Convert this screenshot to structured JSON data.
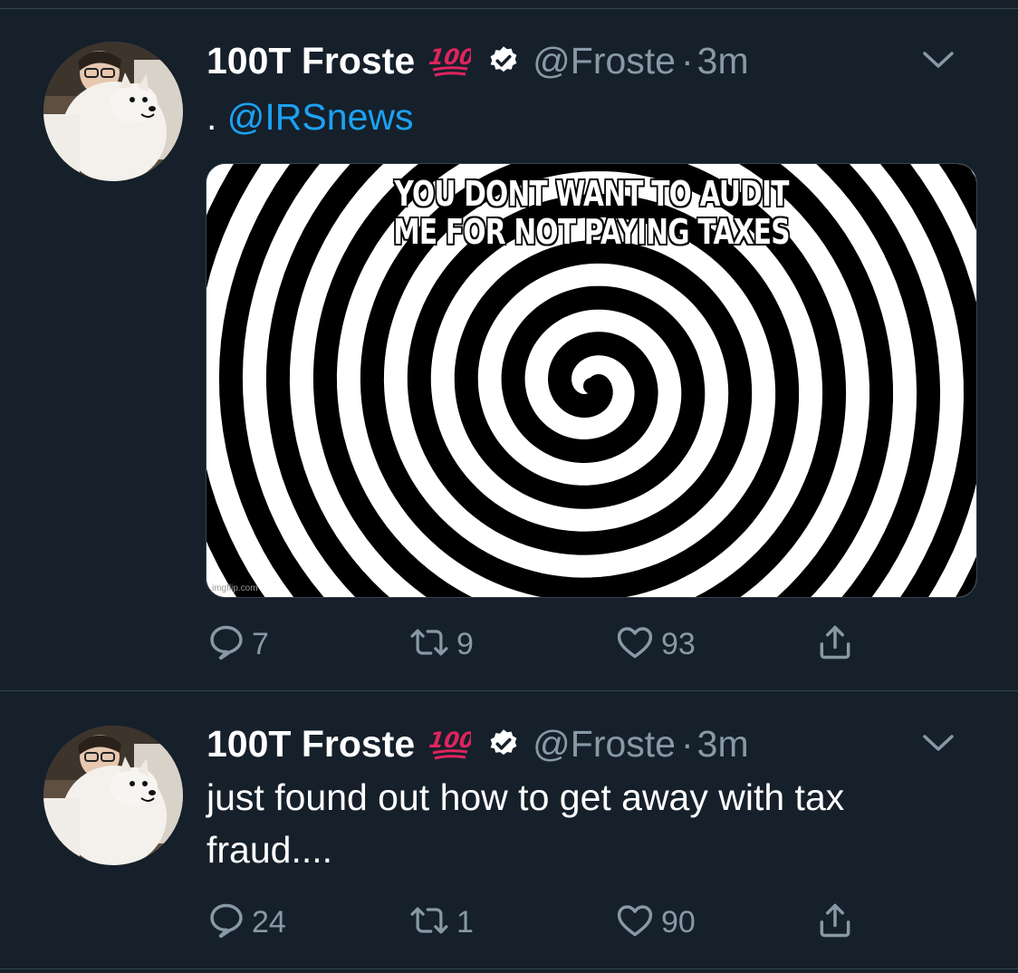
{
  "tweets": [
    {
      "display_name": "100T Froste",
      "emoji": "💯",
      "handle": "@Froste",
      "separator": "·",
      "time": "3m",
      "text_prefix": ". ",
      "mention": "@IRSnews",
      "text": "",
      "media": {
        "caption_line1": "YOU DONT WANT TO AUDIT",
        "caption_line2": "ME FOR NOT PAYING TAXES",
        "watermark": "imgflip.com"
      },
      "replies": "7",
      "retweets": "9",
      "likes": "93"
    },
    {
      "display_name": "100T Froste",
      "emoji": "💯",
      "handle": "@Froste",
      "separator": "·",
      "time": "3m",
      "text": "just found out how to get away with tax fraud....",
      "replies": "24",
      "retweets": "1",
      "likes": "90"
    }
  ],
  "icons": {
    "reply": "speech-bubble-icon",
    "retweet": "retweet-icon",
    "like": "heart-icon",
    "share": "share-icon",
    "verified": "verified-badge-icon",
    "menu": "chevron-down-icon"
  },
  "colors": {
    "background": "#15202b",
    "text": "#ffffff",
    "secondary": "#8899a6",
    "link": "#1da1f2",
    "divider": "#38444d",
    "hundred": "#e0245e"
  }
}
